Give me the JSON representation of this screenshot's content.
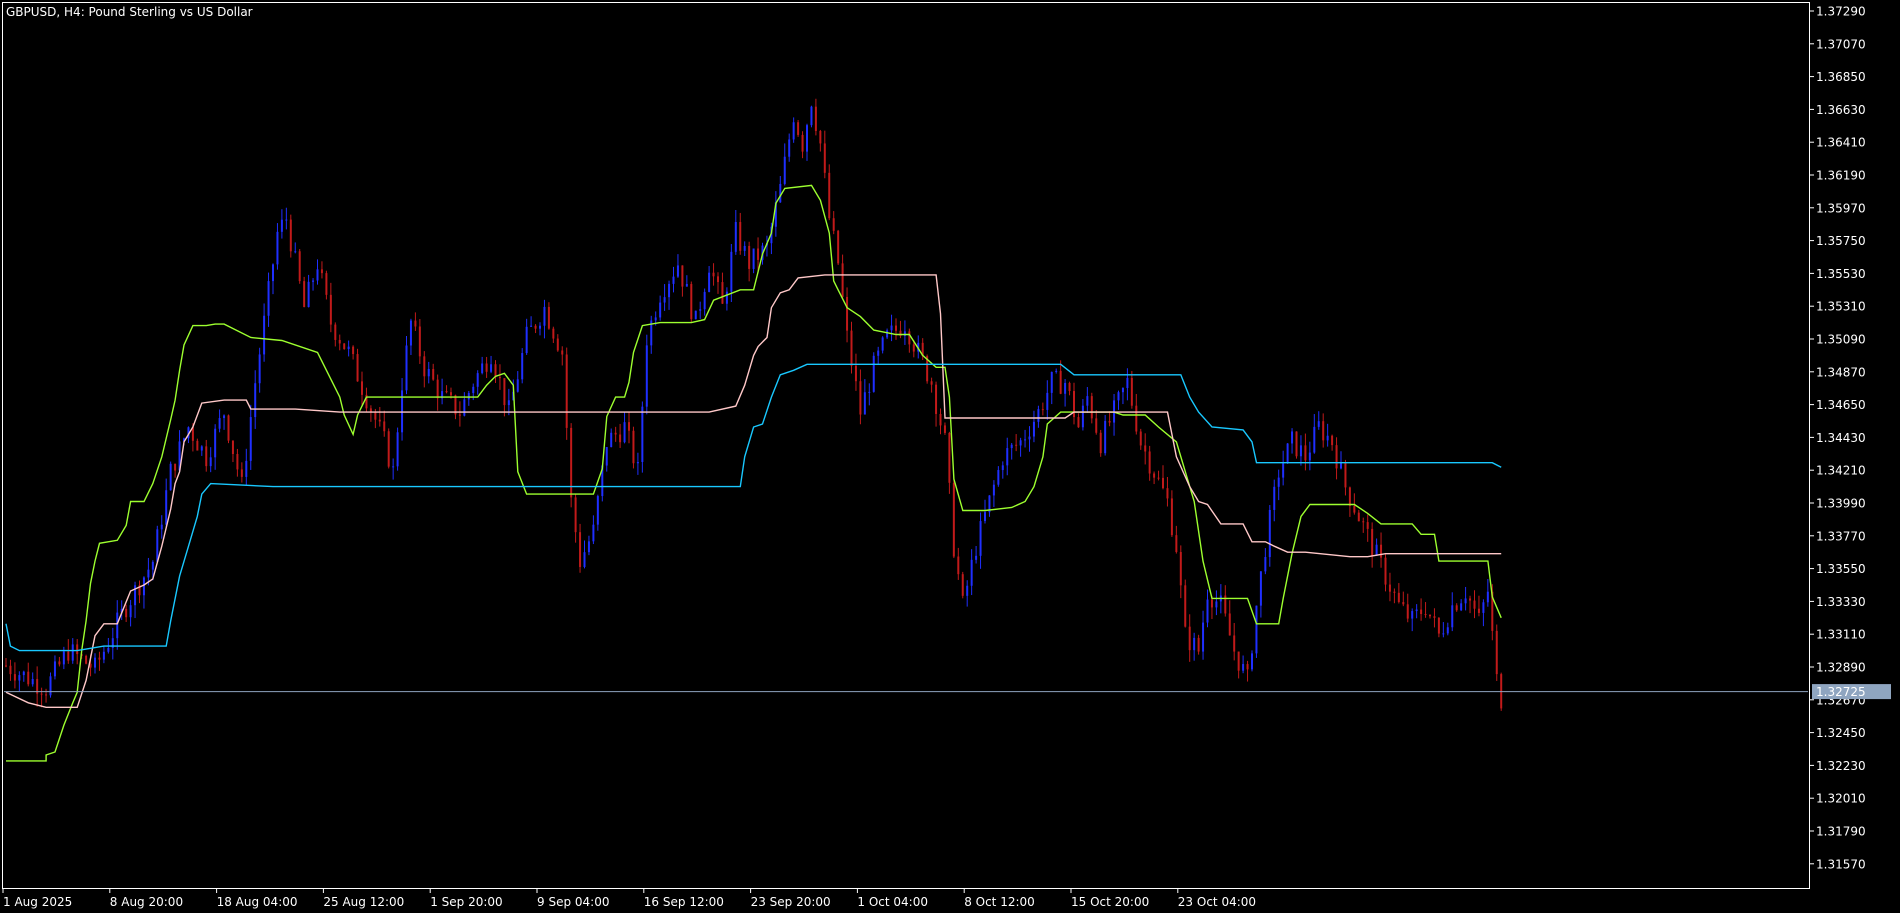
{
  "window": {
    "title": "GBPUSD, H4:  Pound Sterling vs US Dollar"
  },
  "price_line": {
    "label": "1.32725",
    "value": 1.32725,
    "color": "#8fa5c0"
  },
  "colors": {
    "background": "#000000",
    "frame": "#ffffff",
    "bull_candle": "#1f2fff",
    "bear_candle": "#c21a1a",
    "line_green": "#9dff2f",
    "line_pink": "#ffc8c8",
    "line_cyan": "#19c8ff"
  },
  "chart_data": {
    "type": "line",
    "title": "GBPUSD, H4:  Pound Sterling vs US Dollar",
    "xlabel": "",
    "ylabel": "",
    "ylim": [
      1.3146,
      1.3733
    ],
    "grid": false,
    "x_tick_labels": [
      "1 Aug 2025",
      "8 Aug 20:00",
      "18 Aug 04:00",
      "25 Aug 12:00",
      "1 Sep 20:00",
      "9 Sep 04:00",
      "16 Sep 12:00",
      "23 Sep 20:00",
      "1 Oct 04:00",
      "8 Oct 12:00",
      "15 Oct 20:00",
      "23 Oct 04:00"
    ],
    "y_ticks": [
      1.3729,
      1.3707,
      1.3685,
      1.3663,
      1.3641,
      1.3619,
      1.3597,
      1.3575,
      1.3553,
      1.3531,
      1.3509,
      1.3487,
      1.3465,
      1.3443,
      1.3421,
      1.3399,
      1.3377,
      1.3355,
      1.3333,
      1.3311,
      1.3289,
      1.3267,
      1.3245,
      1.3223,
      1.3201,
      1.3179,
      1.3157
    ],
    "y_tick_labels": [
      "1.37290",
      "1.37070",
      "1.36850",
      "1.36630",
      "1.36410",
      "1.36190",
      "1.35970",
      "1.35750",
      "1.35530",
      "1.35310",
      "1.35090",
      "1.34870",
      "1.34650",
      "1.34430",
      "1.34210",
      "1.33990",
      "1.33770",
      "1.33550",
      "1.33330",
      "1.33110",
      "1.32890",
      "1.32670",
      "1.32450",
      "1.32230",
      "1.32010",
      "1.31790",
      "1.31570"
    ],
    "price_path": [
      [
        0,
        1.329
      ],
      [
        9,
        1.3275
      ],
      [
        14,
        1.33
      ],
      [
        20,
        1.3288
      ],
      [
        27,
        1.333
      ],
      [
        33,
        1.336
      ],
      [
        37,
        1.342
      ],
      [
        41,
        1.345
      ],
      [
        45,
        1.343
      ],
      [
        49,
        1.346
      ],
      [
        53,
        1.341
      ],
      [
        56,
        1.348
      ],
      [
        59,
        1.354
      ],
      [
        61,
        1.358
      ],
      [
        63,
        1.359
      ],
      [
        65,
        1.356
      ],
      [
        67,
        1.353
      ],
      [
        70,
        1.356
      ],
      [
        73,
        1.352
      ],
      [
        77,
        1.35
      ],
      [
        81,
        1.347
      ],
      [
        85,
        1.344
      ],
      [
        87,
        1.342
      ],
      [
        89,
        1.348
      ],
      [
        91,
        1.352
      ],
      [
        94,
        1.349
      ],
      [
        98,
        1.347
      ],
      [
        102,
        1.346
      ],
      [
        105,
        1.348
      ],
      [
        109,
        1.35
      ],
      [
        113,
        1.346
      ],
      [
        117,
        1.351
      ],
      [
        121,
        1.353
      ],
      [
        125,
        1.35
      ],
      [
        127,
        1.34
      ],
      [
        129,
        1.336
      ],
      [
        132,
        1.338
      ],
      [
        135,
        1.344
      ],
      [
        139,
        1.345
      ],
      [
        142,
        1.342
      ],
      [
        144,
        1.351
      ],
      [
        147,
        1.354
      ],
      [
        151,
        1.356
      ],
      [
        155,
        1.352
      ],
      [
        158,
        1.356
      ],
      [
        161,
        1.353
      ],
      [
        164,
        1.358
      ],
      [
        167,
        1.356
      ],
      [
        171,
        1.357
      ],
      [
        174,
        1.361
      ],
      [
        177,
        1.366
      ],
      [
        179,
        1.364
      ],
      [
        181,
        1.367
      ],
      [
        183,
        1.364
      ],
      [
        185,
        1.359
      ],
      [
        187,
        1.356
      ],
      [
        189,
        1.351
      ],
      [
        192,
        1.346
      ],
      [
        195,
        1.349
      ],
      [
        198,
        1.351
      ],
      [
        202,
        1.352
      ],
      [
        205,
        1.35
      ],
      [
        208,
        1.348
      ],
      [
        211,
        1.344
      ],
      [
        213,
        1.337
      ],
      [
        215,
        1.333
      ],
      [
        218,
        1.337
      ],
      [
        221,
        1.34
      ],
      [
        224,
        1.343
      ],
      [
        228,
        1.344
      ],
      [
        232,
        1.346
      ],
      [
        235,
        1.348
      ],
      [
        238,
        1.348
      ],
      [
        241,
        1.345
      ],
      [
        243,
        1.347
      ],
      [
        246,
        1.344
      ],
      [
        249,
        1.346
      ],
      [
        252,
        1.348
      ],
      [
        255,
        1.344
      ],
      [
        258,
        1.342
      ],
      [
        261,
        1.34
      ],
      [
        263,
        1.337
      ],
      [
        265,
        1.331
      ],
      [
        268,
        1.33
      ],
      [
        270,
        1.334
      ],
      [
        273,
        1.333
      ],
      [
        276,
        1.33
      ],
      [
        279,
        1.328
      ],
      [
        281,
        1.333
      ],
      [
        283,
        1.337
      ],
      [
        286,
        1.342
      ],
      [
        289,
        1.344
      ],
      [
        292,
        1.343
      ],
      [
        295,
        1.345
      ],
      [
        298,
        1.344
      ],
      [
        301,
        1.341
      ],
      [
        304,
        1.339
      ],
      [
        307,
        1.337
      ],
      [
        310,
        1.335
      ],
      [
        313,
        1.333
      ],
      [
        316,
        1.332
      ],
      [
        319,
        1.333
      ],
      [
        322,
        1.331
      ],
      [
        325,
        1.333
      ],
      [
        328,
        1.334
      ],
      [
        331,
        1.332
      ],
      [
        333,
        1.334
      ],
      [
        335,
        1.328
      ],
      [
        336,
        1.3268
      ]
    ],
    "series": [
      {
        "color": "#9dff2f",
        "points": [
          [
            0,
            1.3226
          ],
          [
            9,
            1.3226
          ],
          [
            9,
            1.323
          ],
          [
            11,
            1.3232
          ],
          [
            13,
            1.325
          ],
          [
            15,
            1.3265
          ],
          [
            16,
            1.3272
          ],
          [
            17,
            1.33
          ],
          [
            18,
            1.332
          ],
          [
            19,
            1.3345
          ],
          [
            20,
            1.336
          ],
          [
            21,
            1.3372
          ],
          [
            25,
            1.3374
          ],
          [
            27,
            1.3384
          ],
          [
            28,
            1.34
          ],
          [
            31,
            1.34
          ],
          [
            33,
            1.3412
          ],
          [
            35,
            1.343
          ],
          [
            37,
            1.3455
          ],
          [
            38,
            1.3468
          ],
          [
            39,
            1.3488
          ],
          [
            40,
            1.3505
          ],
          [
            42,
            1.3518
          ],
          [
            45,
            1.3518
          ],
          [
            47,
            1.3519
          ],
          [
            49,
            1.3519
          ],
          [
            55,
            1.351
          ],
          [
            62,
            1.3508
          ],
          [
            70,
            1.35
          ],
          [
            75,
            1.347
          ],
          [
            76,
            1.3458
          ],
          [
            78,
            1.3445
          ],
          [
            79,
            1.3458
          ],
          [
            81,
            1.347
          ],
          [
            96,
            1.347
          ],
          [
            106,
            1.347
          ],
          [
            108,
            1.3478
          ],
          [
            110,
            1.3484
          ],
          [
            112,
            1.3486
          ],
          [
            114,
            1.3478
          ],
          [
            115,
            1.342
          ],
          [
            117,
            1.3405
          ],
          [
            125,
            1.3405
          ],
          [
            132,
            1.3405
          ],
          [
            134,
            1.3422
          ],
          [
            135,
            1.3457
          ],
          [
            137,
            1.347
          ],
          [
            139,
            1.347
          ],
          [
            140,
            1.348
          ],
          [
            141,
            1.35
          ],
          [
            143,
            1.3518
          ],
          [
            147,
            1.352
          ],
          [
            154,
            1.352
          ],
          [
            157,
            1.3522
          ],
          [
            159,
            1.3535
          ],
          [
            165,
            1.3542
          ],
          [
            168,
            1.3542
          ],
          [
            170,
            1.3566
          ],
          [
            172,
            1.358
          ],
          [
            173,
            1.36
          ],
          [
            175,
            1.361
          ],
          [
            181,
            1.3612
          ],
          [
            183,
            1.3602
          ],
          [
            185,
            1.358
          ],
          [
            186,
            1.3548
          ],
          [
            187,
            1.3542
          ],
          [
            189,
            1.353
          ],
          [
            192,
            1.3524
          ],
          [
            195,
            1.3515
          ],
          [
            200,
            1.3512
          ],
          [
            203,
            1.3512
          ],
          [
            206,
            1.3498
          ],
          [
            209,
            1.349
          ],
          [
            211,
            1.349
          ],
          [
            212,
            1.347
          ],
          [
            213,
            1.3415
          ],
          [
            215,
            1.3394
          ],
          [
            220,
            1.3394
          ],
          [
            226,
            1.3396
          ],
          [
            229,
            1.34
          ],
          [
            231,
            1.341
          ],
          [
            233,
            1.343
          ],
          [
            234,
            1.3452
          ],
          [
            237,
            1.346
          ],
          [
            244,
            1.346
          ],
          [
            249,
            1.346
          ],
          [
            251,
            1.3458
          ],
          [
            256,
            1.3458
          ],
          [
            259,
            1.345
          ],
          [
            263,
            1.344
          ],
          [
            265,
            1.342
          ],
          [
            267,
            1.34
          ],
          [
            269,
            1.336
          ],
          [
            271,
            1.3335
          ],
          [
            275,
            1.3335
          ],
          [
            279,
            1.3335
          ],
          [
            281,
            1.3318
          ],
          [
            286,
            1.3318
          ],
          [
            287,
            1.3335
          ],
          [
            289,
            1.3365
          ],
          [
            291,
            1.339
          ],
          [
            293,
            1.3398
          ],
          [
            303,
            1.3398
          ],
          [
            306,
            1.3392
          ],
          [
            309,
            1.3385
          ],
          [
            316,
            1.3385
          ],
          [
            318,
            1.3378
          ],
          [
            321,
            1.3378
          ],
          [
            322,
            1.336
          ],
          [
            333,
            1.336
          ],
          [
            334,
            1.3336
          ],
          [
            336,
            1.3322
          ]
        ]
      },
      {
        "color": "#ffc8c8",
        "points": [
          [
            0,
            1.3272
          ],
          [
            5,
            1.3265
          ],
          [
            9,
            1.3262
          ],
          [
            16,
            1.3262
          ],
          [
            18,
            1.328
          ],
          [
            20,
            1.331
          ],
          [
            22,
            1.3318
          ],
          [
            25,
            1.3318
          ],
          [
            28,
            1.334
          ],
          [
            31,
            1.3344
          ],
          [
            33,
            1.3348
          ],
          [
            35,
            1.337
          ],
          [
            37,
            1.3395
          ],
          [
            38,
            1.3412
          ],
          [
            39,
            1.342
          ],
          [
            40,
            1.344
          ],
          [
            42,
            1.345
          ],
          [
            44,
            1.3466
          ],
          [
            49,
            1.3468
          ],
          [
            54,
            1.3468
          ],
          [
            55,
            1.3462
          ],
          [
            65,
            1.3462
          ],
          [
            75,
            1.346
          ],
          [
            105,
            1.346
          ],
          [
            125,
            1.346
          ],
          [
            150,
            1.346
          ],
          [
            158,
            1.346
          ],
          [
            164,
            1.3464
          ],
          [
            166,
            1.3478
          ],
          [
            168,
            1.3498
          ],
          [
            169,
            1.3504
          ],
          [
            171,
            1.351
          ],
          [
            172,
            1.353
          ],
          [
            174,
            1.354
          ],
          [
            176,
            1.3542
          ],
          [
            178,
            1.355
          ],
          [
            184,
            1.3552
          ],
          [
            198,
            1.3552
          ],
          [
            209,
            1.3552
          ],
          [
            210,
            1.3526
          ],
          [
            211,
            1.3456
          ],
          [
            225,
            1.3456
          ],
          [
            238,
            1.3456
          ],
          [
            240,
            1.346
          ],
          [
            261,
            1.346
          ],
          [
            263,
            1.343
          ],
          [
            266,
            1.341
          ],
          [
            268,
            1.34
          ],
          [
            270,
            1.3398
          ],
          [
            273,
            1.3385
          ],
          [
            278,
            1.3385
          ],
          [
            280,
            1.3373
          ],
          [
            283,
            1.3373
          ],
          [
            285,
            1.337
          ],
          [
            288,
            1.3366
          ],
          [
            292,
            1.3366
          ],
          [
            302,
            1.3363
          ],
          [
            306,
            1.3363
          ],
          [
            310,
            1.3365
          ],
          [
            322,
            1.3365
          ],
          [
            336,
            1.3365
          ]
        ]
      },
      {
        "color": "#19c8ff",
        "points": [
          [
            0,
            1.3318
          ],
          [
            1,
            1.3303
          ],
          [
            3,
            1.33
          ],
          [
            16,
            1.33
          ],
          [
            22,
            1.3303
          ],
          [
            36,
            1.3303
          ],
          [
            37,
            1.332
          ],
          [
            39,
            1.335
          ],
          [
            41,
            1.337
          ],
          [
            43,
            1.339
          ],
          [
            44,
            1.3405
          ],
          [
            46,
            1.3412
          ],
          [
            60,
            1.341
          ],
          [
            90,
            1.341
          ],
          [
            120,
            1.341
          ],
          [
            150,
            1.341
          ],
          [
            165,
            1.341
          ],
          [
            166,
            1.343
          ],
          [
            168,
            1.345
          ],
          [
            170,
            1.3452
          ],
          [
            172,
            1.347
          ],
          [
            174,
            1.3485
          ],
          [
            177,
            1.3488
          ],
          [
            180,
            1.3492
          ],
          [
            200,
            1.3492
          ],
          [
            220,
            1.3492
          ],
          [
            237,
            1.3492
          ],
          [
            240,
            1.3485
          ],
          [
            250,
            1.3485
          ],
          [
            264,
            1.3485
          ],
          [
            266,
            1.347
          ],
          [
            268,
            1.346
          ],
          [
            271,
            1.345
          ],
          [
            278,
            1.3448
          ],
          [
            280,
            1.344
          ],
          [
            281,
            1.3426
          ],
          [
            300,
            1.3426
          ],
          [
            320,
            1.3426
          ],
          [
            334,
            1.3426
          ],
          [
            336,
            1.3423
          ]
        ]
      }
    ]
  }
}
